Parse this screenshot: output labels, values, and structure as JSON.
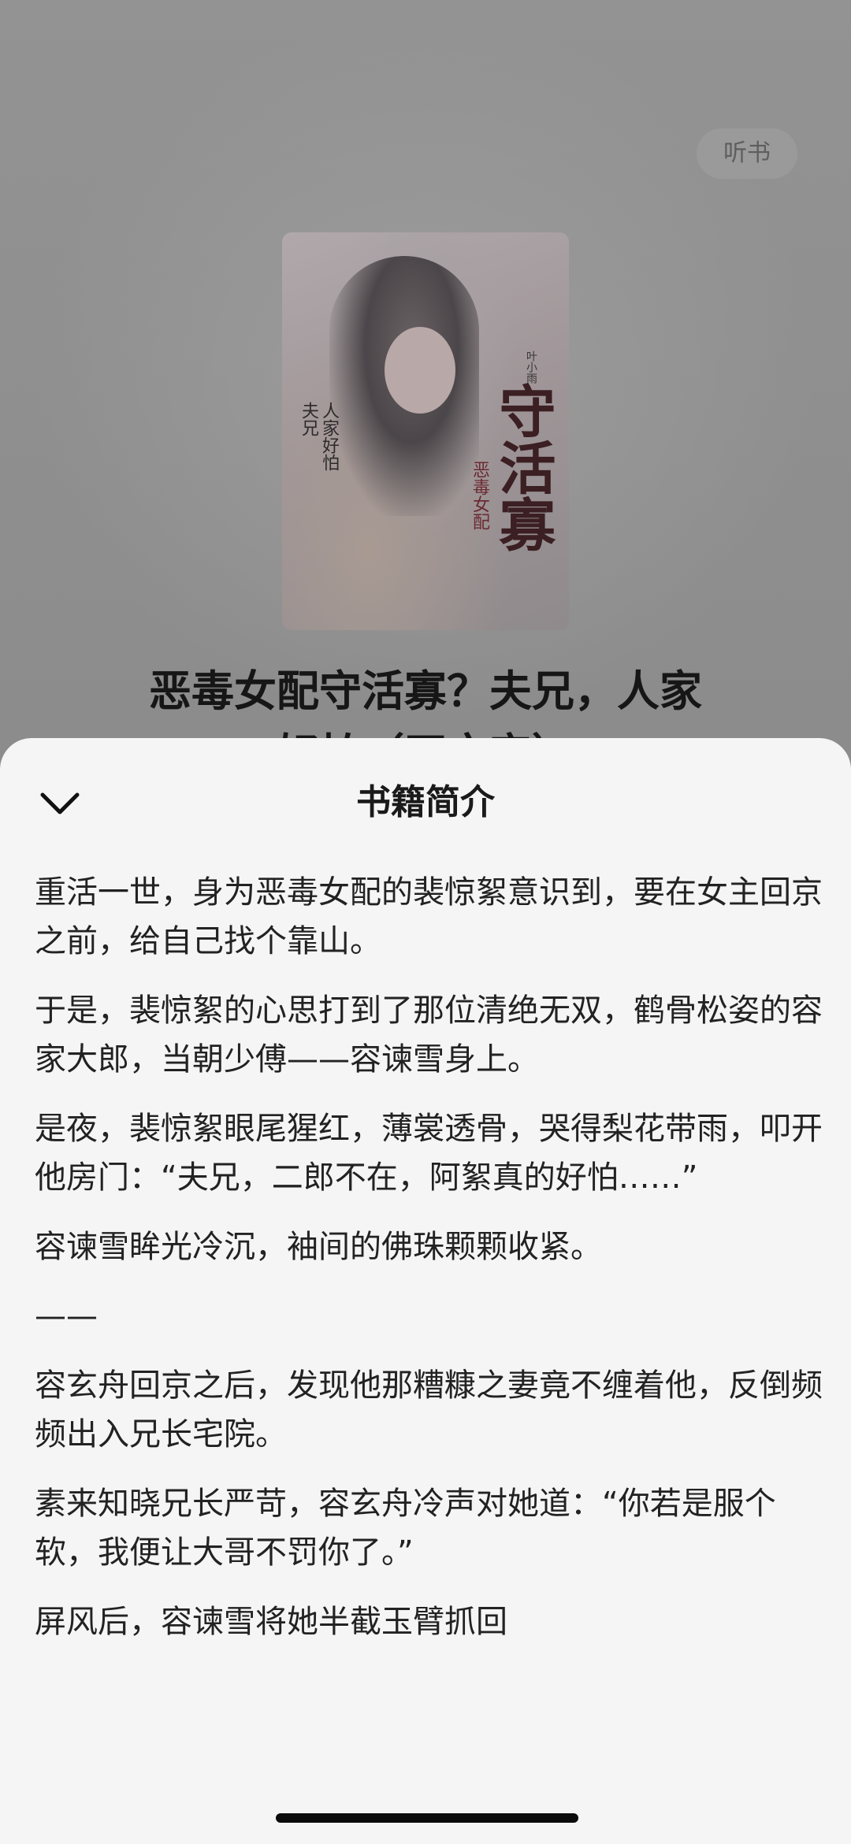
{
  "header": {
    "listen_label": "听书"
  },
  "cover": {
    "title": "守活寡",
    "subtitle": "恶毒女配",
    "side_text": "人家好怕",
    "side_text_2": "夫兄",
    "author": "叶小雨"
  },
  "book": {
    "title_line1": "恶毒女配守活寡？夫兄，人家",
    "title_line2": "好怕（正文完）"
  },
  "intro_sheet": {
    "title": "书籍简介",
    "paragraphs": [
      "重活一世，身为恶毒女配的裴惊絮意识到，要在女主回京之前，给自己找个靠山。",
      "于是，裴惊絮的心思打到了那位清绝无双，鹤骨松姿的容家大郎，当朝少傅——容谏雪身上。",
      "是夜，裴惊絮眼尾猩红，薄裳透骨，哭得梨花带雨，叩开他房门：“夫兄，二郎不在，阿絮真的好怕……”",
      "容谏雪眸光冷沉，袖间的佛珠颗颗收紧。",
      "——",
      "容玄舟回京之后，发现他那糟糠之妻竟不缠着他，反倒频频出入兄长宅院。",
      "素来知晓兄长严苛，容玄舟冷声对她道：“你若是服个软，我便让大哥不罚你了。”",
      "屏风后，容谏雪将她半截玉臂抓回"
    ]
  },
  "colors": {
    "overlay": "#8f8f8f",
    "sheet_bg": "#f5f5f5",
    "text": "#222222"
  }
}
